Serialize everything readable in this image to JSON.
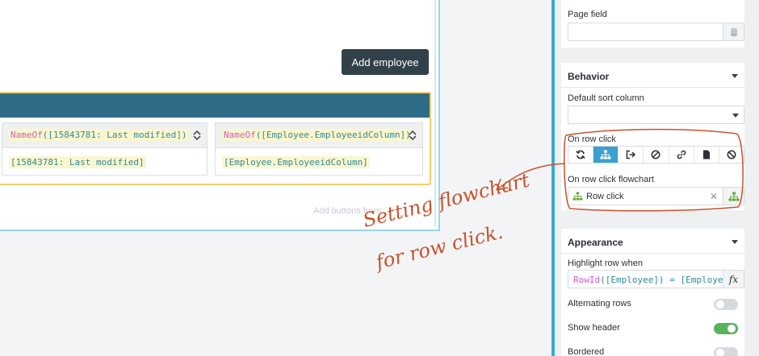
{
  "canvas": {
    "add_employee_label": "Add employee",
    "add_buttons_hint": "Add buttons from",
    "table": {
      "columns": [
        {
          "header_fn": "NameOf",
          "header_arg": "([15843781: Last modified])",
          "cell": "[15843781: Last modified]"
        },
        {
          "header_fn": "NameOf",
          "header_arg": "([Employee.EmployeeidColumn])",
          "cell": "[Employee.EmployeeidColumn]"
        }
      ]
    }
  },
  "panel": {
    "page_field": {
      "label": "Page field",
      "value": ""
    },
    "behavior": {
      "title": "Behavior",
      "default_sort_label": "Default sort column",
      "default_sort_value": "",
      "on_row_click_label": "On row click",
      "on_row_click_options": [
        "refresh-icon",
        "flowchart-icon",
        "navigate-icon",
        "cancel-icon",
        "link-icon",
        "document-icon",
        "disable-icon"
      ],
      "on_row_click_selected": "flowchart-icon",
      "flowchart_label": "On row click flowchart",
      "flowchart_value": "Row click"
    },
    "appearance": {
      "title": "Appearance",
      "highlight_label": "Highlight row when",
      "highlight_fn": "RowId",
      "highlight_expr": "([Employee]) = [Employe…",
      "fx_label": "fx",
      "alternating_label": "Alternating rows",
      "alternating_on": false,
      "show_header_label": "Show header",
      "show_header_on": true,
      "bordered_label": "Bordered",
      "bordered_on": false
    }
  },
  "annotation": {
    "line1": "Setting flowchart",
    "line2": "for row click.",
    "color": "#c8522b"
  },
  "colors": {
    "accent": "#3aa9d6",
    "titlebar": "#2f6b86",
    "button_dark": "#324049",
    "toggle_on": "#56b45b",
    "highlight_border": "#f1cf6e"
  }
}
